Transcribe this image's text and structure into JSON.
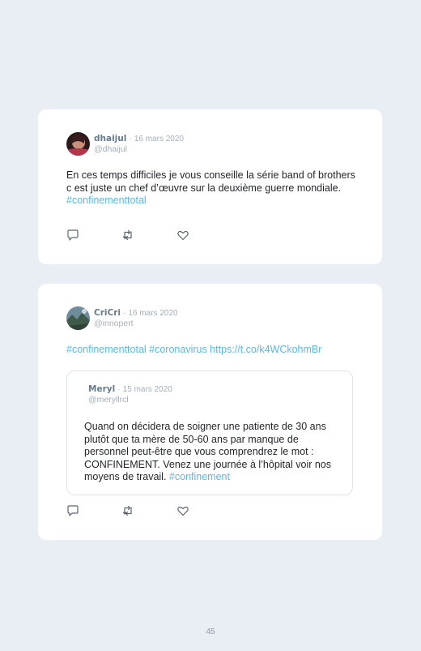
{
  "tweets": [
    {
      "name": "dhaijul",
      "sep": "·",
      "date": "16 mars 2020",
      "handle": "@dhaijul",
      "text": "En ces temps difficiles je vous conseille la série band of brothers c est juste un chef d’œuvre sur la deuxième guerre mondiale. ",
      "hashtag": "#confinementtotal"
    },
    {
      "name": "CriCri",
      "sep": "·",
      "date": "16 mars 2020",
      "handle": "@innopert",
      "links": "#confinementtotal #coronavirus https://t.co/k4WCkohmBr",
      "quoted": {
        "name": "Meryl",
        "sep": "·",
        "date": "15 mars 2020",
        "handle": "@meryllrcl",
        "text": "Quand on décidera de soigner une patiente de 30 ans plutôt que ta mère de 50-60 ans par manque de personnel peut-être que vous comprendrez le mot : CONFINEMENT. Venez une journée à l’hôpital voir nos moyens de travail. ",
        "hashtag": "#confinement"
      }
    }
  ],
  "icons": [
    "reply-icon",
    "retweet-icon",
    "like-icon"
  ],
  "page_number": "45",
  "colors": {
    "background": "#e9edf4",
    "card": "#ffffff",
    "hashtag": "#5cb8e0",
    "name": "#667b8c",
    "muted": "#a3afba"
  }
}
